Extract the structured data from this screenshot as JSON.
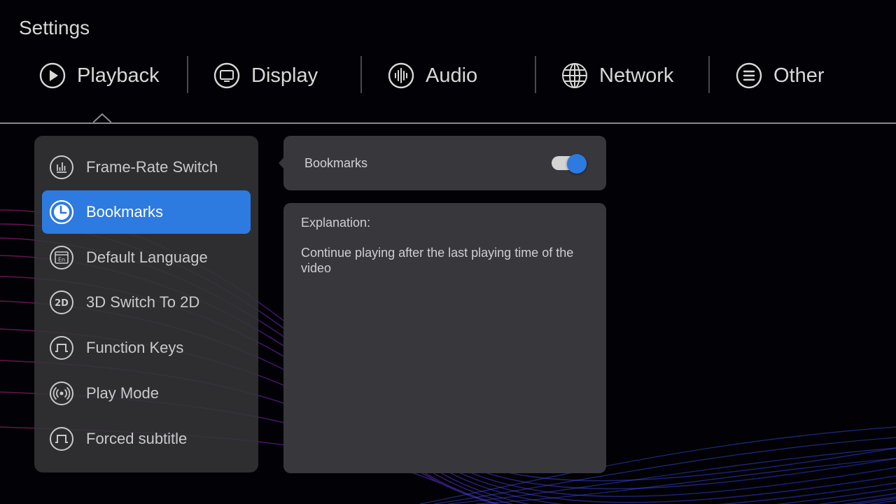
{
  "page": {
    "title": "Settings"
  },
  "tabs": [
    {
      "label": "Playback",
      "icon": "play-circle-icon",
      "active": true
    },
    {
      "label": "Display",
      "icon": "monitor-icon",
      "active": false
    },
    {
      "label": "Audio",
      "icon": "audio-wave-icon",
      "active": false
    },
    {
      "label": "Network",
      "icon": "globe-icon",
      "active": false
    },
    {
      "label": "Other",
      "icon": "menu-lines-icon",
      "active": false
    }
  ],
  "menu": {
    "items": [
      {
        "label": "Frame-Rate Switch",
        "icon": "bar-chart-icon",
        "selected": false
      },
      {
        "label": "Bookmarks",
        "icon": "clock-icon",
        "selected": true
      },
      {
        "label": "Default Language",
        "icon": "language-en-icon",
        "selected": false
      },
      {
        "label": "3D Switch To 2D",
        "icon": "badge-2d-icon",
        "selected": false
      },
      {
        "label": "Function Keys",
        "icon": "pulse-square-icon",
        "selected": false
      },
      {
        "label": "Play Mode",
        "icon": "broadcast-icon",
        "selected": false
      },
      {
        "label": "Forced subtitle",
        "icon": "pulse-square-icon",
        "selected": false
      }
    ]
  },
  "detail": {
    "toggle_label": "Bookmarks",
    "toggle_on": true,
    "explanation_heading": "Explanation:",
    "explanation_text": "Continue playing after the last playing time of the video"
  },
  "colors": {
    "accent": "#2d7ae0",
    "panel": "#38383c",
    "background": "#020206"
  },
  "icons": {
    "2d_badge_text": "2D",
    "en_badge_text": "En"
  }
}
